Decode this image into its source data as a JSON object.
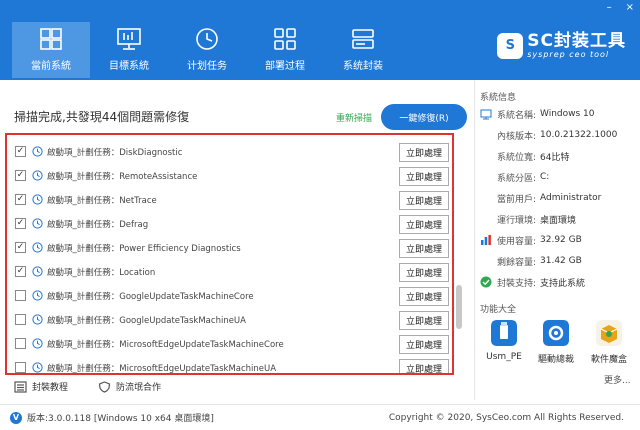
{
  "window": {
    "minimize": "–",
    "close": "×"
  },
  "nav": [
    {
      "label": "當前系統",
      "icon": "windows-icon",
      "active": true
    },
    {
      "label": "目標系統",
      "icon": "monitor-icon",
      "active": false
    },
    {
      "label": "计划任务",
      "icon": "clock-icon",
      "active": false
    },
    {
      "label": "部署过程",
      "icon": "grid-icon",
      "active": false
    },
    {
      "label": "系统封装",
      "icon": "drive-icon",
      "active": false
    }
  ],
  "logo": {
    "badge": "S",
    "main": "SC封装工具",
    "sub": "sysprep ceo tool"
  },
  "scan": {
    "title": "掃描完成,共發現44個問題需修復",
    "rescan": "重新掃描",
    "fix_all": "一鍵修復(R)"
  },
  "list": {
    "action_label": "立即處理",
    "rows": [
      {
        "text": "啟動項_計劃任務：DiskDiagnostic",
        "checked": true
      },
      {
        "text": "啟動項_計劃任務：RemoteAssistance",
        "checked": true
      },
      {
        "text": "啟動項_計劃任務：NetTrace",
        "checked": true
      },
      {
        "text": "啟動項_計劃任務：Defrag",
        "checked": true
      },
      {
        "text": "啟動項_計劃任務：Power Efficiency Diagnostics",
        "checked": true
      },
      {
        "text": "啟動項_計劃任務：Location",
        "checked": true
      },
      {
        "text": "啟動項_計劃任務：GoogleUpdateTaskMachineCore",
        "checked": false
      },
      {
        "text": "啟動項_計劃任務：GoogleUpdateTaskMachineUA",
        "checked": false
      },
      {
        "text": "啟動項_計劃任務：MicrosoftEdgeUpdateTaskMachineCore",
        "checked": false
      },
      {
        "text": "啟動項_計劃任務：MicrosoftEdgeUpdateTaskMachineUA",
        "checked": false
      }
    ]
  },
  "bottom_links": {
    "tutorial": "封裝教程",
    "anti_bundle": "防流氓合作"
  },
  "sysinfo": {
    "title": "系統信息",
    "rows": [
      {
        "key": "系統名稱:",
        "value": "Windows 10",
        "icon": "monitor-icon"
      },
      {
        "key": "內核版本:",
        "value": "10.0.21322.1000",
        "icon": ""
      },
      {
        "key": "系統位寬:",
        "value": "64比特",
        "icon": ""
      },
      {
        "key": "系統分區:",
        "value": "C:",
        "icon": ""
      },
      {
        "key": "當前用戶:",
        "value": "Administrator",
        "icon": ""
      },
      {
        "key": "運行環境:",
        "value": "桌面環境",
        "icon": ""
      },
      {
        "key": "使用容量:",
        "value": "32.92 GB",
        "icon": "disk-usage-icon"
      },
      {
        "key": "剩餘容量:",
        "value": "31.42 GB",
        "icon": ""
      },
      {
        "key": "封裝支持:",
        "value": "支持此系統",
        "icon": "check-circle-icon"
      }
    ]
  },
  "functions": {
    "title": "功能大全",
    "items": [
      {
        "label": "Usm_PE",
        "icon": "usb-icon",
        "color": "#1f78d6"
      },
      {
        "label": "驅動總裁",
        "icon": "gear-icon",
        "color": "#1f78d6"
      },
      {
        "label": "軟件魔盒",
        "icon": "box-icon",
        "color": "#e8a317"
      }
    ],
    "more": "更多..."
  },
  "status": {
    "version": "版本:3.0.0.118 [Windows 10 x64 桌面環境]",
    "copyright": "Copyright © 2020, SysCeo.com All Rights Reserved."
  },
  "colors": {
    "accent": "#1f78d6",
    "nav_active": "#4d97e3",
    "highlight_border": "#e0322e",
    "rescan": "#2fa84f"
  }
}
